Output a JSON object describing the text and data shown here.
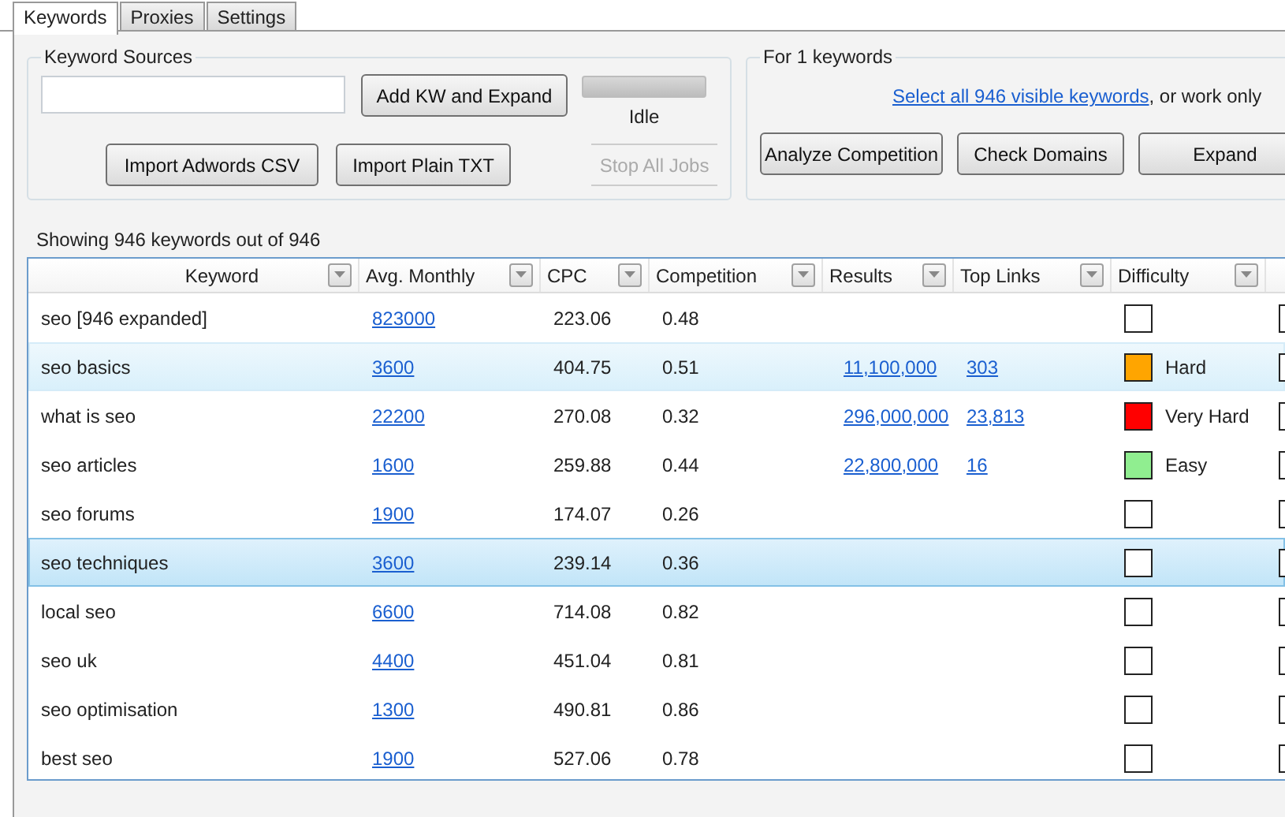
{
  "tabs": [
    {
      "label": "Keywords",
      "selected": true
    },
    {
      "label": "Proxies",
      "selected": false
    },
    {
      "label": "Settings",
      "selected": false
    }
  ],
  "keyword_sources": {
    "title": "Keyword Sources",
    "add_button": "Add KW and Expand",
    "progress": {
      "level": 0
    },
    "status": "Idle",
    "import_buttons": [
      "Import Adwords CSV",
      "Import Plain TXT"
    ],
    "stop_button": {
      "label": "Stop All Jobs",
      "disabled": true
    }
  },
  "selection": {
    "title": "For 1 keywords",
    "link": "Select all 946 visible keywords",
    "text": ", or work only",
    "buttons": [
      "Analyze Competition",
      "Check Domains",
      "Expand"
    ]
  },
  "summary": "Showing 946 keywords out of 946",
  "table": {
    "columns": [
      "Keyword",
      "Avg. Monthly",
      "CPC",
      "Competition",
      "Results",
      "Top Links",
      "Difficulty"
    ],
    "rows": [
      {
        "keyword": "seo [946 expanded]",
        "avg_monthly": "823000",
        "cpc": "223.06",
        "competition": "0.48",
        "color": "#ffffff",
        "selected": false,
        "hovered": false
      },
      {
        "keyword": "seo basics",
        "avg_monthly": "3600",
        "cpc": "404.75",
        "competition": "0.51",
        "results": "11,100,000",
        "top_links": "303",
        "color": "#ffa500",
        "difficulty": "Hard",
        "selected": false,
        "hovered": true
      },
      {
        "keyword": "what is seo",
        "avg_monthly": "22200",
        "cpc": "270.08",
        "competition": "0.32",
        "results": "296,000,000",
        "top_links": "23,813",
        "color": "#ff0000",
        "difficulty": "Very Hard",
        "selected": false,
        "hovered": false
      },
      {
        "keyword": "seo articles",
        "avg_monthly": "1600",
        "cpc": "259.88",
        "competition": "0.44",
        "results": "22,800,000",
        "top_links": "16",
        "color": "#90ee90",
        "difficulty": "Easy",
        "selected": false,
        "hovered": false
      },
      {
        "keyword": "seo forums",
        "avg_monthly": "1900",
        "cpc": "174.07",
        "competition": "0.26",
        "color": "#ffffff",
        "selected": false,
        "hovered": false
      },
      {
        "keyword": "seo techniques",
        "avg_monthly": "3600",
        "cpc": "239.14",
        "competition": "0.36",
        "color": "#ffffff",
        "selected": true,
        "hovered": false
      },
      {
        "keyword": "local seo",
        "avg_monthly": "6600",
        "cpc": "714.08",
        "competition": "0.82",
        "color": "#ffffff",
        "selected": false,
        "hovered": false
      },
      {
        "keyword": "seo uk",
        "avg_monthly": "4400",
        "cpc": "451.04",
        "competition": "0.81",
        "color": "#ffffff",
        "selected": false,
        "hovered": false
      },
      {
        "keyword": "seo optimisation",
        "avg_monthly": "1300",
        "cpc": "490.81",
        "competition": "0.86",
        "color": "#ffffff",
        "selected": false,
        "hovered": false
      },
      {
        "keyword": "best seo",
        "avg_monthly": "1900",
        "cpc": "527.06",
        "competition": "0.78",
        "color": "#ffffff",
        "selected": false,
        "hovered": false
      }
    ]
  }
}
